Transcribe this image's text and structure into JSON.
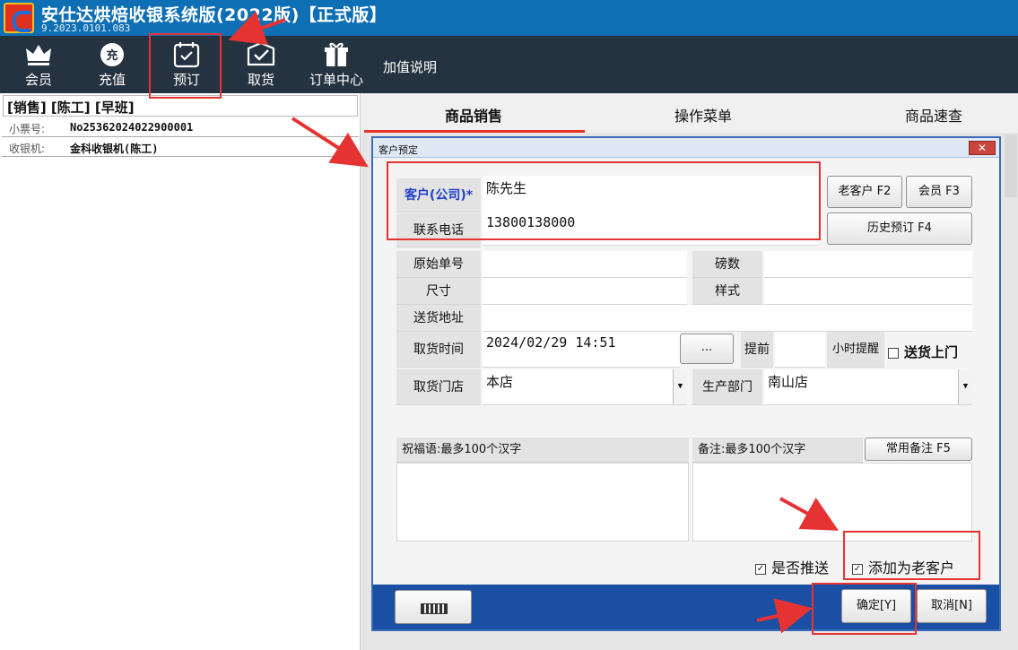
{
  "window": {
    "title": "安仕达烘焙收银系统版(2022版)【正式版】",
    "version": "9.2023.0101.083",
    "logo_icon": "app-logo-icon"
  },
  "toolbar": {
    "items": [
      {
        "label": "会员",
        "icon": "crown-icon"
      },
      {
        "label": "充值",
        "icon": "recharge-icon",
        "icon_text": "充"
      },
      {
        "label": "预订",
        "icon": "calendar-icon"
      },
      {
        "label": "取货",
        "icon": "pickup-box-icon"
      },
      {
        "label": "订单中心",
        "icon": "gift-icon"
      },
      {
        "label": "加值说明"
      }
    ]
  },
  "left_panel": {
    "session": "[销售] [陈工] [早班]",
    "rows": [
      {
        "key": "小票号:",
        "value": "No25362024022900001"
      },
      {
        "key": "收银机:",
        "value": "金科收银机(陈工)"
      }
    ]
  },
  "tabs": [
    "商品销售",
    "操作菜单",
    "商品速查"
  ],
  "dialog": {
    "title": "客户预定",
    "close": "✕",
    "customer_label": "客户(公司)*",
    "customer_value": "陈先生",
    "phone_label": "联系电话",
    "phone_value": "13800138000",
    "old_customer_btn": "老客户 F2",
    "member_btn": "会员 F3",
    "history_btn": "历史预订 F4",
    "orig_no_label": "原始单号",
    "orig_no_value": "",
    "pounds_label": "磅数",
    "pounds_value": "",
    "size_label": "尺寸",
    "size_value": "",
    "style_label": "样式",
    "style_value": "",
    "address_label": "送货地址",
    "address_value": "",
    "pickup_time_label": "取货时间",
    "pickup_time_value": "2024/02/29 14:51",
    "pickup_time_btn": "...",
    "advance_label": "提前",
    "advance_value": "",
    "hour_remind_label": "小时提醒",
    "delivery_label": "送货上门",
    "delivery_checked": false,
    "pickup_store_label": "取货门店",
    "pickup_store_value": "本店",
    "production_dept_label": "生产部门",
    "production_dept_value": "南山店",
    "blessing_label": "祝福语:最多100个汉字",
    "blessing_value": "",
    "remark_label": "备注:最多100个汉字",
    "remark_value": "",
    "common_remark_btn": "常用备注 F5",
    "push_label": "是否推送",
    "push_checked": true,
    "add_old_label": "添加为老客户",
    "add_old_checked": true,
    "keyboard_icon": "keyboard-icon",
    "ok_btn": "确定[Y]",
    "cancel_btn": "取消[N]"
  },
  "colors": {
    "titlebar": "#0f6fb4",
    "toolbar": "#253240",
    "tab_active_underline": "#e5332a",
    "dialog_footer": "#1a4fa3",
    "annotation_red": "#e53333",
    "required_label": "#1f3fc9"
  }
}
